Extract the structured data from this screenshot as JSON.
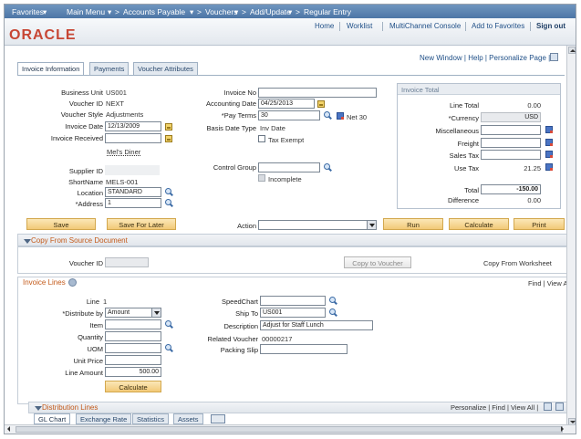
{
  "nav": {
    "favorites": "Favorites",
    "main_menu": "Main Menu",
    "accounts_payable": "Accounts Payable",
    "vouchers": "Vouchers",
    "add_update": "Add/Update",
    "regular_entry": "Regular Entry",
    "sep": ">",
    "dropdown_caret": "▾"
  },
  "header": {
    "logo": "ORACLE",
    "home": "Home",
    "worklist": "Worklist",
    "multichannel": "MultiChannel Console",
    "add_favorites": "Add to Favorites",
    "sign_out": "Sign out"
  },
  "page_links": "New Window | Help | Personalize Page |",
  "tabs": [
    {
      "label": "Invoice Information"
    },
    {
      "label": "Payments"
    },
    {
      "label": "Voucher Attributes"
    }
  ],
  "invoice": {
    "business_unit_label": "Business Unit",
    "business_unit": "US001",
    "voucher_id_label": "Voucher ID",
    "voucher_id": "NEXT",
    "voucher_style_label": "Voucher Style",
    "voucher_style": "Adjustments",
    "invoice_date_label": "Invoice Date",
    "invoice_date": "12/13/2009",
    "invoice_received_label": "Invoice Received",
    "invoice_received": "",
    "supplier_name": "Mel's Diner",
    "supplier_id_label": "Supplier ID",
    "supplier_id": "",
    "shortname_label": "ShortName",
    "shortname": "MELS-001",
    "location_label": "Location",
    "location": "STANDARD",
    "address_label": "*Address",
    "address": "1",
    "invoice_no_label": "Invoice No",
    "invoice_no": "",
    "accounting_date_label": "Accounting Date",
    "accounting_date": "04/25/2013",
    "pay_terms_label": "*Pay Terms",
    "pay_terms": "30",
    "pay_terms_desc": "Net 30",
    "basis_date_type_label": "Basis Date Type",
    "basis_date_type": "Inv Date",
    "tax_exempt_label": "Tax Exempt",
    "control_group_label": "Control Group",
    "control_group": "",
    "incomplete_label": "Incomplete"
  },
  "totals": {
    "title": "Invoice Total",
    "line_total_label": "Line Total",
    "line_total": "0.00",
    "currency_label": "*Currency",
    "currency": "USD",
    "misc_label": "Miscellaneous",
    "freight_label": "Freight",
    "sales_tax_label": "Sales Tax",
    "use_tax_label": "Use Tax",
    "use_tax": "21.25",
    "total_label": "Total",
    "total": "-150.00",
    "difference_label": "Difference",
    "difference": "0.00"
  },
  "actions": {
    "save": "Save",
    "save_later": "Save For Later",
    "action_label": "Action",
    "action_value": "",
    "run": "Run",
    "calculate": "Calculate",
    "print": "Print"
  },
  "copy_source": {
    "title": "Copy From Source Document",
    "voucher_id_label": "Voucher ID",
    "voucher_id": "",
    "copy_to_voucher": "Copy to Voucher",
    "copy_worksheet": "Copy From Worksheet"
  },
  "invoice_lines": {
    "title": "Invoice Lines",
    "find_view": "Find | View All",
    "line_label": "Line",
    "line": "1",
    "distribute_label": "*Distribute by",
    "distribute": "Amount",
    "item_label": "Item",
    "quantity_label": "Quantity",
    "uom_label": "UOM",
    "unit_price_label": "Unit Price",
    "line_amount_label": "Line Amount",
    "line_amount": "500.00",
    "calculate": "Calculate",
    "speedchart_label": "SpeedChart",
    "ship_to_label": "Ship To",
    "ship_to": "US001",
    "description_label": "Description",
    "description": "Adjust for Staff Lunch",
    "related_voucher_label": "Related Voucher",
    "related_voucher": "00000217",
    "packing_slip_label": "Packing Slip"
  },
  "distribution": {
    "title": "Distribution Lines",
    "links": "Personalize | Find | View All |",
    "tabs": [
      {
        "label": "GL Chart"
      },
      {
        "label": "Exchange Rate"
      },
      {
        "label": "Statistics"
      },
      {
        "label": "Assets"
      }
    ]
  }
}
